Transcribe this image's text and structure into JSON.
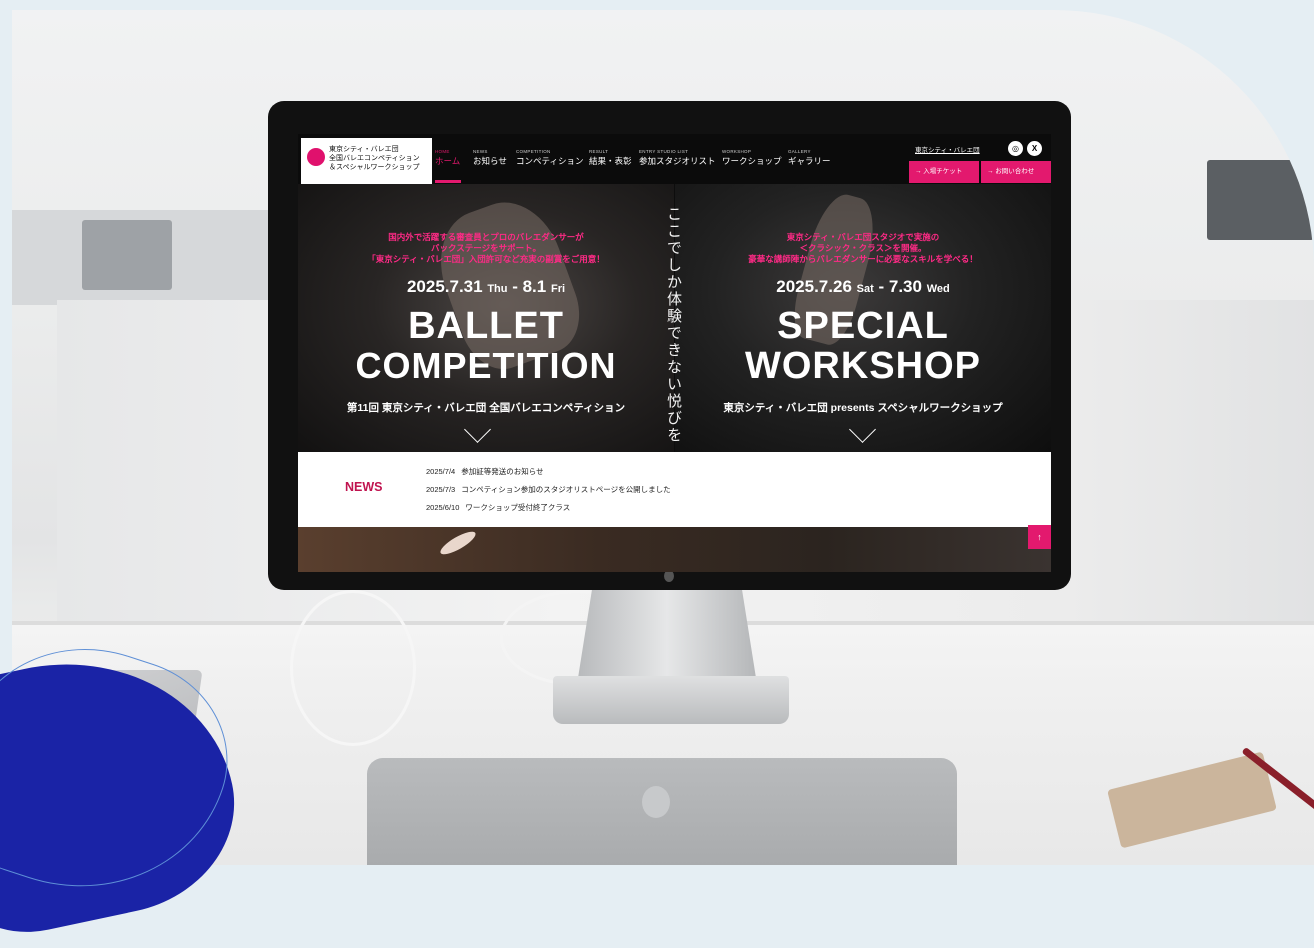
{
  "site": {
    "logo_text": "東京シティ・バレエ団\n全国バレエコンペティション\n＆スペシャルワークショップ",
    "nav": [
      {
        "en": "HOME",
        "jp": "ホーム",
        "active": true
      },
      {
        "en": "NEWS",
        "jp": "お知らせ"
      },
      {
        "en": "COMPETITION",
        "jp": "コンペティション"
      },
      {
        "en": "RESULT",
        "jp": "結果・表彰"
      },
      {
        "en": "ENTRY STUDIO LIST",
        "jp": "参加スタジオリスト"
      },
      {
        "en": "WORKSHOP",
        "jp": "ワークショップ"
      },
      {
        "en": "GALLERY",
        "jp": "ギャラリー"
      }
    ],
    "city_link": "東京シティ・バレエ団",
    "sns": {
      "instagram_icon": "instagram-icon",
      "x_icon": "x-icon"
    },
    "cta_ticket": "→ 入場チケット",
    "cta_contact": "→ お問い合わせ",
    "colors": {
      "accent": "#e3196e",
      "news_label": "#c0134f"
    }
  },
  "hero_left": {
    "pink_lines": [
      "国内外で活躍する審査員とプロのバレエダンサーが",
      "バックステージをサポート。",
      "「東京シティ・バレエ団」入団許可など充実の副賞をご用意！"
    ],
    "date_main": "2025.7.31",
    "date_day1": "Thu",
    "date_sep": " - 8.1",
    "date_day2": "Fri",
    "title_line1": "BALLET",
    "title_line2": "COMPETITION",
    "subtitle": "第11回 東京シティ・バレエ団 全国バレエコンペティション"
  },
  "hero_vertical": "ここでしか体験できない悦びを",
  "hero_right": {
    "pink_lines": [
      "東京シティ・バレエ団スタジオで実施の",
      "＜クラシック・クラス＞を開催。",
      "豪華な講師陣からバレエダンサーに必要なスキルを学べる！"
    ],
    "date_main": "2025.7.26",
    "date_day1": "Sat",
    "date_sep": " - 7.30",
    "date_day2": "Wed",
    "title_line1": "SPECIAL",
    "title_line2": "WORKSHOP",
    "subtitle": "東京シティ・バレエ団 presents スペシャルワークショップ"
  },
  "news": {
    "label": "NEWS",
    "items": [
      {
        "date": "2025/7/4",
        "text": "参加証等発送のお知らせ"
      },
      {
        "date": "2025/7/3",
        "text": "コンペティション参加のスタジオリストページを公開しました"
      },
      {
        "date": "2025/6/10",
        "text": "ワークショップ受付終了クラス"
      }
    ]
  },
  "to_top": "↑"
}
